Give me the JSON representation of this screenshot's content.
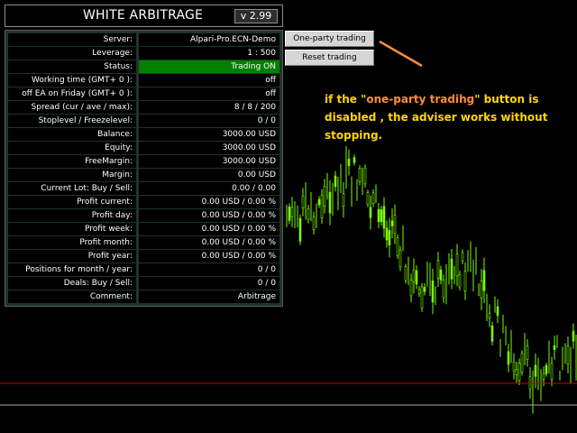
{
  "header": {
    "title": "WHITE ARBITRAGE",
    "version": "v 2.99"
  },
  "info_rows": [
    {
      "label": "Server:",
      "value": "Alpari-Pro.ECN-Demo"
    },
    {
      "label": "Leverage:",
      "value": "1 : 500"
    },
    {
      "label": "Status:",
      "value": "Trading ON",
      "highlight": "#008000"
    },
    {
      "label": "Working time (GMT+ 0 ):",
      "value": "off"
    },
    {
      "label": "off EA on Friday (GMT+ 0 ):",
      "value": "off"
    },
    {
      "label": "Spread (cur / ave / max):",
      "value": "8 / 8 / 200"
    },
    {
      "label": "Stoplevel / Freezelevel:",
      "value": "0 / 0"
    },
    {
      "label": "Balance:",
      "value": "3000.00 USD"
    },
    {
      "label": "Equity:",
      "value": "3000.00 USD"
    },
    {
      "label": "FreeMargin:",
      "value": "3000.00 USD"
    },
    {
      "label": "Margin:",
      "value": "0.00 USD"
    },
    {
      "label": "Current Lot:  Buy  /  Sell:",
      "value": "0.00  /  0.00"
    },
    {
      "label": "Profit current:",
      "value": "0.00 USD / 0.00 %"
    },
    {
      "label": "Profit day:",
      "value": "0.00 USD / 0.00 %"
    },
    {
      "label": "Profit week:",
      "value": "0.00 USD / 0.00 %"
    },
    {
      "label": "Profit month:",
      "value": "0.00 USD / 0.00 %"
    },
    {
      "label": "Profit year:",
      "value": "0.00 USD / 0.00 %"
    },
    {
      "label": "Positions for month / year:",
      "value": "0  /  0"
    },
    {
      "label": "Deals: Buy / Sell:",
      "value": "0  /  0"
    },
    {
      "label": "Comment:",
      "value": "Arbitrage"
    }
  ],
  "buttons": {
    "one_party": "One-party  trading",
    "reset": "Reset trading"
  },
  "annotation": {
    "before": "if the \"",
    "highlight": "one-party tradihg",
    "after": "\" button is disabled , the adviser works without stopping."
  },
  "colors": {
    "candle": "#7cfc00",
    "background": "#000000",
    "price_line": "#c80000",
    "level_line": "#a8a8a8",
    "arrow": "#ff8c3a",
    "note_text": "#ffd700",
    "status_on": "#008000"
  }
}
